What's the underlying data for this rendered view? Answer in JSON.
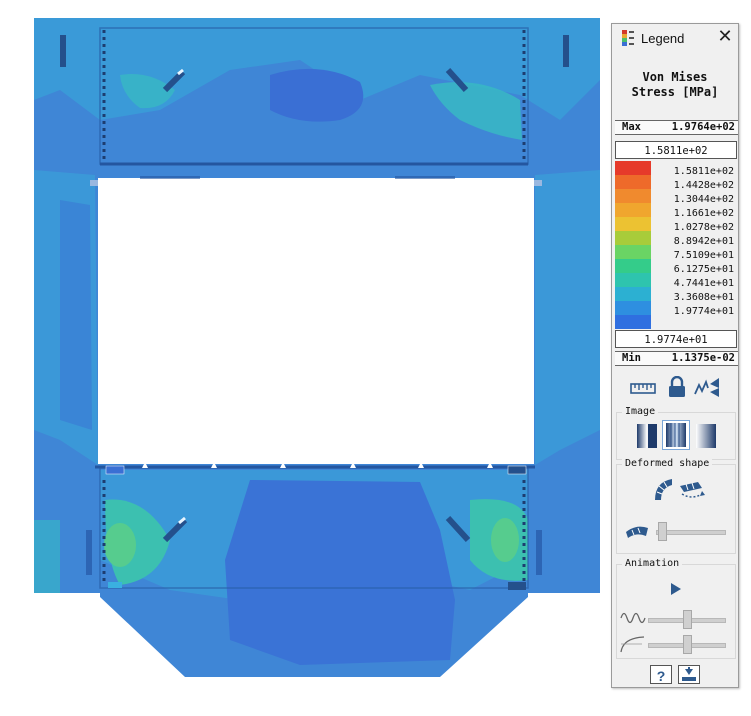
{
  "legend": {
    "window_title": "Legend",
    "result_title_line1": "Von Mises",
    "result_title_line2": "Stress [MPa]",
    "max_label": "Max",
    "max_value": "1.9764e+02",
    "upper_limit": "1.5811e+02",
    "lower_limit": "1.9774e+01",
    "min_label": "Min",
    "min_value": "1.1375e-02",
    "levels": [
      "1.5811e+02",
      "1.4428e+02",
      "1.3044e+02",
      "1.1661e+02",
      "1.0278e+02",
      "8.8942e+01",
      "7.5109e+01",
      "6.1275e+01",
      "4.7441e+01",
      "3.3608e+01",
      "1.9774e+01"
    ],
    "colors": [
      "#e63a2a",
      "#ee6a2a",
      "#f08a2e",
      "#f0a62e",
      "#ecc232",
      "#a8cc3a",
      "#6ad464",
      "#34cc8a",
      "#2ec4ae",
      "#2cb0d2",
      "#2e8fe0",
      "#2f6fe0"
    ],
    "image_section": "Image",
    "deformed_section": "Deformed shape",
    "animation_section": "Animation",
    "help_label": "?"
  },
  "model_colors": {
    "base": "#3f86d6",
    "low": "#3a7ad6",
    "mid": "#3aa0d8",
    "teal": "#32b8c8",
    "green": "#4cc8a4",
    "dark": "#24508c"
  }
}
